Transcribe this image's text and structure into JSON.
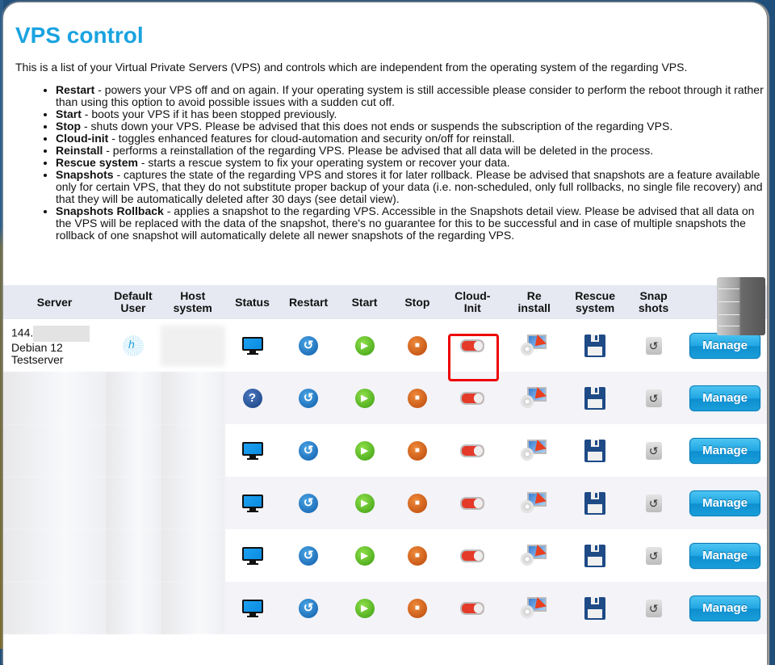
{
  "page": {
    "title": "VPS control",
    "intro": "This is a list of your Virtual Private Servers (VPS) and controls which are independent from the operating system of the regarding VPS."
  },
  "features": [
    {
      "name": "Restart",
      "desc": " - powers your VPS off and on again. If your operating system is still accessible please consider to perform the reboot through it rather than using this option to avoid possible issues with a sudden cut off."
    },
    {
      "name": "Start",
      "desc": " - boots your VPS if it has been stopped previously."
    },
    {
      "name": "Stop",
      "desc": " - shuts down your VPS. Please be advised that this does not ends or suspends the subscription of the regarding VPS."
    },
    {
      "name": "Cloud-init",
      "desc": " - toggles enhanced features for cloud-automation and security on/off for reinstall."
    },
    {
      "name": "Reinstall",
      "desc": " - performs a reinstallation of the regarding VPS. Please be advised that all data will be deleted in the process."
    },
    {
      "name": "Rescue system",
      "desc": " - starts a rescue system to fix your operating system or recover your data."
    },
    {
      "name": "Snapshots",
      "desc": " - captures the state of the regarding VPS and stores it for later rollback. Please be advised that snapshots are a feature available only for certain VPS, that they do not substitute proper backup of your data (i.e. non-scheduled, only full rollbacks, no single file recovery) and that they will be automatically deleted after 30 days (see detail view)."
    },
    {
      "name": "Snapshots Rollback",
      "desc": " - applies a snapshot to the regarding VPS. Accessible in the Snapshots detail view. Please be advised that all data on the VPS will be replaced with the data of the snapshot, there's no guarantee for this to be successful and in case of multiple snapshots the rollback of one snapshot will automatically delete all newer snapshots of the regarding VPS."
    }
  ],
  "table": {
    "headers": {
      "server": "Server",
      "default_user": [
        "Default",
        "User"
      ],
      "host_system": [
        "Host",
        "system"
      ],
      "status": "Status",
      "restart": "Restart",
      "start": "Start",
      "stop": "Stop",
      "cloud_init": [
        "Cloud-",
        "Init"
      ],
      "reinstall": [
        "Re",
        "install"
      ],
      "rescue": [
        "Rescue",
        "system"
      ],
      "snapshots": [
        "Snap",
        "shots"
      ]
    },
    "rows": [
      {
        "ip": "144.",
        "os": "Debian 12",
        "name": "Testserver",
        "status": "monitor-icon",
        "cloud_init": "off",
        "manage": "Manage"
      },
      {
        "ip": "",
        "os": "",
        "name": "",
        "status": "question-icon",
        "cloud_init": "off",
        "manage": "Manage"
      },
      {
        "ip": "",
        "os": "",
        "name": "",
        "status": "monitor-icon",
        "cloud_init": "off",
        "manage": "Manage"
      },
      {
        "ip": "",
        "os": "",
        "name": "",
        "status": "monitor-icon",
        "cloud_init": "off",
        "manage": "Manage"
      },
      {
        "ip": "",
        "os": "",
        "name": "",
        "status": "monitor-icon",
        "cloud_init": "off",
        "manage": "Manage"
      },
      {
        "ip": "",
        "os": "",
        "name": "",
        "status": "monitor-icon",
        "cloud_init": "off",
        "manage": "Manage"
      }
    ]
  },
  "colors": {
    "title": "#1aa3e0",
    "header_bg": "#e6e9f2",
    "highlight": "#e00000",
    "button": "#1fa6e3"
  }
}
